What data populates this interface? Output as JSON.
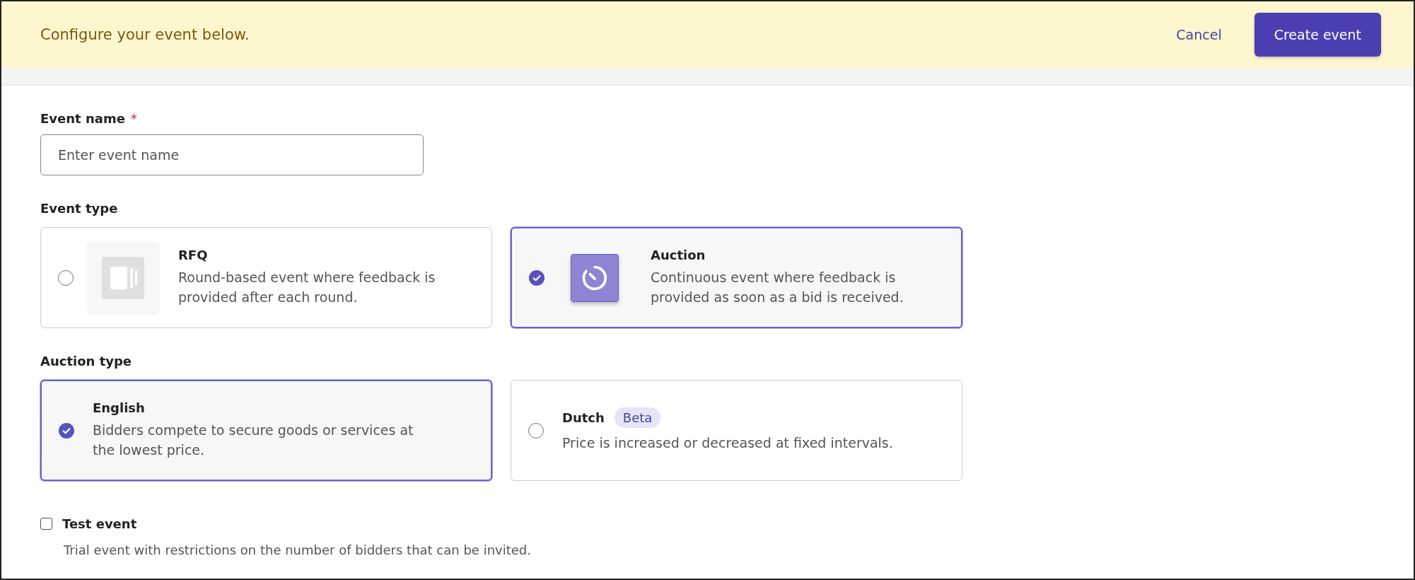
{
  "banner": {
    "message": "Configure your event below.",
    "cancel": "Cancel",
    "create": "Create event"
  },
  "event_name": {
    "label": "Event name",
    "required_mark": "*",
    "placeholder": "Enter event name"
  },
  "event_type": {
    "label": "Event type",
    "options": [
      {
        "title": "RFQ",
        "description": "Round-based event where feedback is provided after each round.",
        "selected": false
      },
      {
        "title": "Auction",
        "description": "Continuous event where feedback is provided as soon as a bid is received.",
        "selected": true
      }
    ]
  },
  "auction_type": {
    "label": "Auction type",
    "options": [
      {
        "title": "English",
        "description": "Bidders compete to secure goods or services at the lowest price.",
        "selected": true
      },
      {
        "title": "Dutch",
        "badge": "Beta",
        "description": "Price is increased or decreased at fixed intervals.",
        "selected": false
      }
    ]
  },
  "test_event": {
    "label": "Test event",
    "description": "Trial event with restrictions on the number of bidders that can be invited.",
    "checked": false
  }
}
